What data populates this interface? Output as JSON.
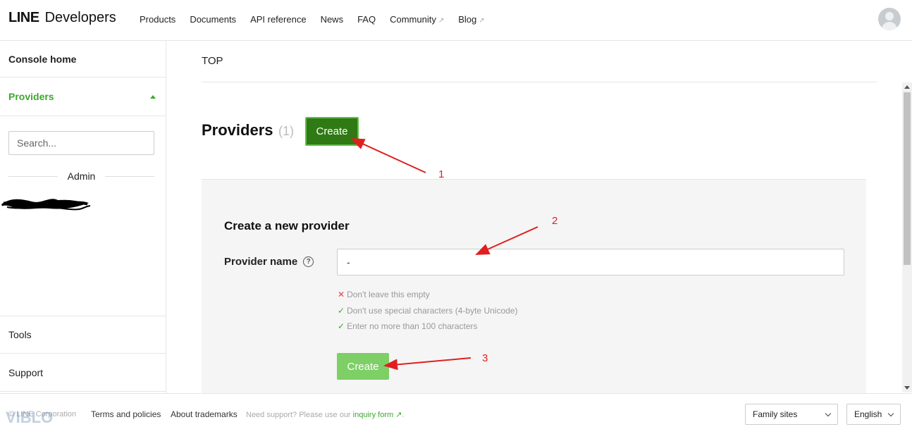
{
  "header": {
    "logo_bold": "LINE",
    "logo_light": "Developers",
    "nav": [
      {
        "label": "Products",
        "external": false
      },
      {
        "label": "Documents",
        "external": false
      },
      {
        "label": "API reference",
        "external": false
      },
      {
        "label": "News",
        "external": false
      },
      {
        "label": "FAQ",
        "external": false
      },
      {
        "label": "Community",
        "external": true
      },
      {
        "label": "Blog",
        "external": true
      }
    ],
    "avatar_icon": "user-avatar-icon"
  },
  "sidebar": {
    "console_home": "Console home",
    "providers": "Providers",
    "search_placeholder": "Search...",
    "admin_label": "Admin",
    "tools": "Tools",
    "support": "Support"
  },
  "main": {
    "breadcrumb": "TOP",
    "title": "Providers",
    "count": "(1)",
    "create_top_label": "Create",
    "panel": {
      "title": "Create a new provider",
      "field_label": "Provider name",
      "field_value": "-",
      "rules": [
        {
          "status": "error",
          "text": "Don't leave this empty"
        },
        {
          "status": "ok",
          "text": "Don't use special characters (4-byte Unicode)"
        },
        {
          "status": "ok",
          "text": "Enter no more than 100 characters"
        }
      ],
      "create_label": "Create"
    }
  },
  "annotations": [
    "1",
    "2",
    "3"
  ],
  "footer": {
    "corp": "© LINE Corporation",
    "terms": "Terms and policies",
    "trademarks": "About trademarks",
    "support_prefix": "Need support? Please use our",
    "support_link": "inquiry form",
    "support_suffix": ".",
    "family_sites": "Family sites",
    "language": "English"
  },
  "watermark": "VIBLO",
  "colors": {
    "brand_green": "#3ca82d",
    "create_dark": "#2f7a14",
    "create_light": "#7ecf66",
    "arrow_red": "#e02020"
  }
}
